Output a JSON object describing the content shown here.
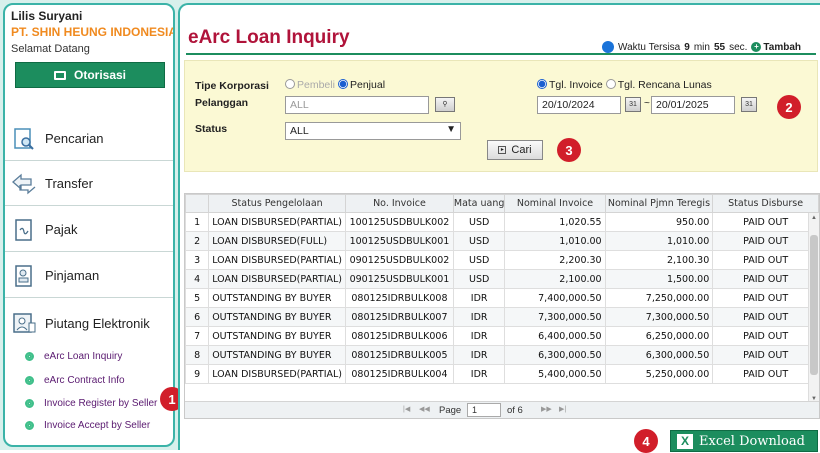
{
  "user": {
    "name": "Lilis Suryani",
    "company": "PT. SHIN HEUNG INDONESIA",
    "welcome": "Selamat Datang"
  },
  "auth_button": {
    "label": "Otorisasi",
    "icon": "monitor-icon"
  },
  "menu": [
    {
      "label": "Pencarian",
      "icon": "search-document-icon"
    },
    {
      "label": "Transfer",
      "icon": "transfer-icon"
    },
    {
      "label": "Pajak",
      "icon": "tax-document-icon"
    },
    {
      "label": "Pinjaman",
      "icon": "loan-document-icon"
    },
    {
      "label": "Piutang Elektronik",
      "icon": "receivable-icon"
    }
  ],
  "submenu": [
    {
      "label": "eArc Loan Inquiry"
    },
    {
      "label": "eArc Contract Info"
    },
    {
      "label": "Invoice Register by Seller"
    },
    {
      "label": "Invoice Accept by Seller"
    }
  ],
  "header": {
    "title": "eArc Loan Inquiry",
    "timer_prefix": "Waktu Tersisa",
    "minutes": "9",
    "min_unit": "min",
    "seconds": "55",
    "sec_unit": "sec.",
    "extend_label": "Tambah"
  },
  "filter": {
    "tipe_label": "Tipe Korporasi",
    "tipe_options": [
      {
        "label": "Pembeli",
        "selected": false
      },
      {
        "label": "Penjual",
        "selected": true
      }
    ],
    "pelanggan_label": "Pelanggan",
    "pelanggan_value": "ALL",
    "status_label": "Status",
    "status_value": "ALL",
    "date_options": [
      {
        "label": "Tgl. Invoice",
        "selected": true
      },
      {
        "label": "Tgl. Rencana Lunas",
        "selected": false
      }
    ],
    "date_from": "20/10/2024",
    "date_separator": "~",
    "date_to": "20/01/2025",
    "search_label": "Cari"
  },
  "badges": {
    "b1": "1",
    "b2": "2",
    "b3": "3",
    "b4": "4"
  },
  "table": {
    "columns": [
      "",
      "Status Pengelolaan",
      "No. Invoice",
      "Mata uang",
      "Nominal Invoice",
      "Nominal Pjmn Teregis",
      "Status Disburse"
    ],
    "rows": [
      [
        "1",
        "LOAN DISBURSED(PARTIAL)",
        "100125USDBULK002",
        "USD",
        "1,020.55",
        "950.00",
        "PAID OUT"
      ],
      [
        "2",
        "LOAN DISBURSED(FULL)",
        "100125USDBULK001",
        "USD",
        "1,010.00",
        "1,010.00",
        "PAID OUT"
      ],
      [
        "3",
        "LOAN DISBURSED(PARTIAL)",
        "090125USDBULK002",
        "USD",
        "2,200.30",
        "2,100.30",
        "PAID OUT"
      ],
      [
        "4",
        "LOAN DISBURSED(PARTIAL)",
        "090125USDBULK001",
        "USD",
        "2,100.00",
        "1,500.00",
        "PAID OUT"
      ],
      [
        "5",
        "OUTSTANDING BY BUYER",
        "080125IDRBULK008",
        "IDR",
        "7,400,000.50",
        "7,250,000.00",
        "PAID OUT"
      ],
      [
        "6",
        "OUTSTANDING BY BUYER",
        "080125IDRBULK007",
        "IDR",
        "7,300,000.50",
        "7,300,000.50",
        "PAID OUT"
      ],
      [
        "7",
        "OUTSTANDING BY BUYER",
        "080125IDRBULK006",
        "IDR",
        "6,400,000.50",
        "6,250,000.00",
        "PAID OUT"
      ],
      [
        "8",
        "OUTSTANDING BY BUYER",
        "080125IDRBULK005",
        "IDR",
        "6,300,000.50",
        "6,300,000.50",
        "PAID OUT"
      ],
      [
        "9",
        "LOAN DISBURSED(PARTIAL)",
        "080125IDRBULK004",
        "IDR",
        "5,400,000.50",
        "5,250,000.00",
        "PAID OUT"
      ]
    ]
  },
  "pager": {
    "page_label": "Page",
    "current": "1",
    "of_label": "of 6"
  },
  "excel": {
    "label": "Excel Download"
  },
  "colors": {
    "brand_green": "#1c8d5e",
    "title_red": "#b0133a",
    "company_orange": "#f08a1f",
    "badge_red": "#d11e2a",
    "filter_bg": "#fbf9d4"
  }
}
